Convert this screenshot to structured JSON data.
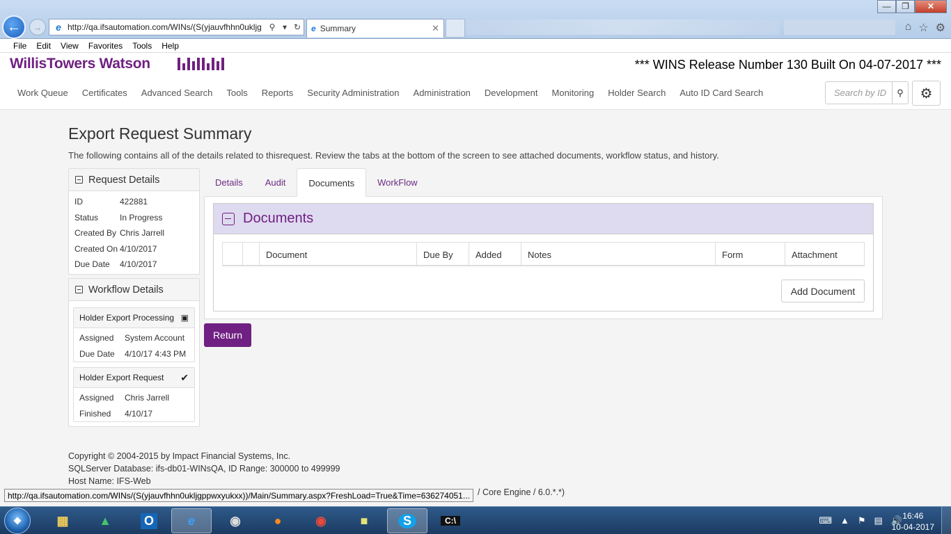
{
  "browser": {
    "url": "http://qa.ifsautomation.com/WINs/(S(yjauvfhhn0ukljg",
    "tab_title": "Summary",
    "menu": [
      "File",
      "Edit",
      "View",
      "Favorites",
      "Tools",
      "Help"
    ],
    "status_url": "http://qa.ifsautomation.com/WINs/(S(yjauvfhhn0ukljgppwxyukxx))/Main/Summary.aspx?FreshLoad=True&Time=636274051..."
  },
  "app": {
    "brand": "WillisTowers Watson",
    "release": "*** WINS Release Number 130 Built On 04-07-2017 ***",
    "nav": [
      "Work Queue",
      "Certificates",
      "Advanced Search",
      "Tools",
      "Reports",
      "Security Administration",
      "Administration",
      "Development",
      "Monitoring",
      "Holder Search",
      "Auto ID Card Search"
    ],
    "search_placeholder": "Search by ID"
  },
  "page": {
    "title": "Export Request Summary",
    "description": "The following contains all of the details related to thisrequest. Review the tabs at the bottom of the screen to see attached documents, workflow status, and history."
  },
  "request_details": {
    "heading": "Request Details",
    "rows": [
      {
        "label": "ID",
        "value": "422881"
      },
      {
        "label": "Status",
        "value": "In Progress"
      },
      {
        "label": "Created By",
        "value": "Chris Jarrell"
      },
      {
        "label": "Created On",
        "value": "4/10/2017"
      },
      {
        "label": "Due Date",
        "value": "4/10/2017"
      }
    ]
  },
  "workflow_details": {
    "heading": "Workflow Details",
    "steps": [
      {
        "name": "Holder Export Processing",
        "icon": "inbox-icon",
        "rows": [
          {
            "label": "Assigned",
            "value": "System Account"
          },
          {
            "label": "Due Date",
            "value": "4/10/17 4:43 PM"
          }
        ]
      },
      {
        "name": "Holder Export Request",
        "icon": "checkmark-icon",
        "rows": [
          {
            "label": "Assigned",
            "value": "Chris Jarrell"
          },
          {
            "label": "Finished",
            "value": "4/10/17"
          }
        ]
      }
    ]
  },
  "tabs": [
    "Details",
    "Audit",
    "Documents",
    "WorkFlow"
  ],
  "active_tab": "Documents",
  "documents": {
    "heading": "Documents",
    "columns": [
      "",
      "",
      "Document",
      "Due By",
      "Added",
      "Notes",
      "Form",
      "Attachment"
    ],
    "add_button": "Add Document"
  },
  "return_button": "Return",
  "footer": {
    "copyright": "Copyright © 2004-2015 by Impact Financial Systems, Inc.",
    "database": "SQLServer Database: ifs-db01-WINsQA, ID Range: 300000 to 499999",
    "host": "Host Name: IFS-Web",
    "engine_tail": "/ Core Engine / 6.0.*.*)"
  },
  "taskbar": {
    "time": "16:46",
    "date": "10-04-2017"
  },
  "colors": {
    "brand": "#702082",
    "doc_header_bg": "#dedaef"
  }
}
